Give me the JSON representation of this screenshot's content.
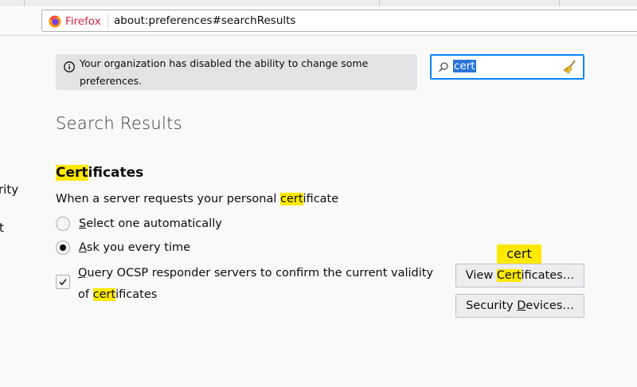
{
  "browser": {
    "identity_label": "Firefox",
    "url": "about:preferences#searchResults"
  },
  "notice": {
    "text": "Your organization has disabled the ability to change some preferences."
  },
  "search": {
    "query": "cert",
    "icon": "search-icon",
    "clear_icon": "broom-icon"
  },
  "page_title": "Search Results",
  "sidebar_fragments": [
    "rity",
    "t"
  ],
  "certificates": {
    "title_highlight": "Cert",
    "title_rest": "ificates",
    "description_before": "When a server requests your personal ",
    "description_highlight": "cert",
    "description_after": "ificate",
    "options": [
      {
        "access_key": "S",
        "label_rest": "elect one automatically",
        "checked": false
      },
      {
        "access_key": "A",
        "label_rest": "sk you every time",
        "checked": true
      }
    ],
    "ocsp": {
      "access_key": "Q",
      "label_line1_rest": "uery OCSP responder servers to confirm the current validity",
      "label_line2_before": "of ",
      "label_line2_highlight": "cert",
      "label_line2_after": "ificates",
      "checked": true
    },
    "buttons": {
      "view_before": "View ",
      "view_highlight": "Cert",
      "view_after": "ificates…",
      "devices_before": "Security ",
      "devices_access_key": "D",
      "devices_after": "evices…"
    },
    "tooltip": "cert"
  },
  "colors": {
    "highlight": "#ffe900",
    "accent": "#0a84ff",
    "firefox_label": "#d7264c"
  }
}
